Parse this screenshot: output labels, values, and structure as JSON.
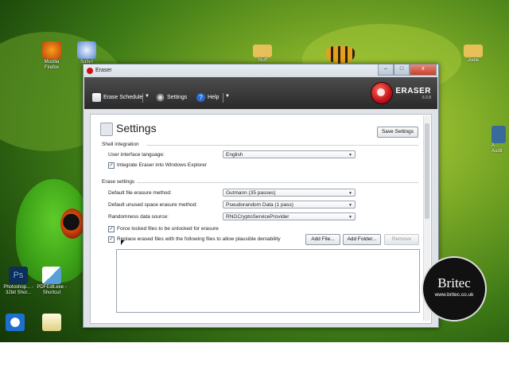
{
  "desktop": {
    "icons": [
      {
        "label": "Mozilla\nFirefox",
        "icon": "firefox-icon"
      },
      {
        "label": "Safari",
        "icon": "safari-icon"
      },
      {
        "label": "Stuff",
        "icon": "folder-icon"
      },
      {
        "label": "Jodie",
        "icon": "folder-icon"
      },
      {
        "label": "Photoshop... - 32bit Shor...",
        "icon": "photoshop-icon"
      },
      {
        "label": "PDFEdit.exe - Shortcut",
        "icon": "pdfedit-icon"
      },
      {
        "label": "A\nAudit",
        "icon": "audit-icon"
      }
    ],
    "accent": "#3ea418"
  },
  "window": {
    "title": "Eraser",
    "controls": {
      "minimize": "–",
      "maximize": "□",
      "close": "x"
    }
  },
  "toolbar": {
    "erase_schedule": "Erase Schedule",
    "settings": "Settings",
    "help": "Help",
    "logo_name": "ERASER",
    "logo_version": "6.0.8"
  },
  "page": {
    "title": "Settings",
    "save_button": "Save Settings"
  },
  "shell": {
    "section": "Shell integration",
    "language_label": "User interface language:",
    "language_value": "English",
    "integrate_label": "Integrate Eraser into Windows Explorer",
    "integrate_checked": true
  },
  "erase": {
    "section": "Erase settings",
    "file_method_label": "Default file erasure method:",
    "file_method_value": "Gutmann (35 passes)",
    "unused_method_label": "Default unused space erasure method:",
    "unused_method_value": "Pseudorandom Data (1 pass)",
    "random_label": "Randomness data source:",
    "random_value": "RNGCryptoServiceProvider",
    "force_label": "Force locked files to be unlocked for erasure",
    "force_checked": true,
    "replace_label": "Replace erased files with the following files to allow plausible deniability",
    "replace_checked": true,
    "add_file": "Add File...",
    "add_folder": "Add Folder...",
    "remove": "Remove"
  },
  "watermark": {
    "name": "Britec",
    "url": "www.britec.co.uk"
  }
}
